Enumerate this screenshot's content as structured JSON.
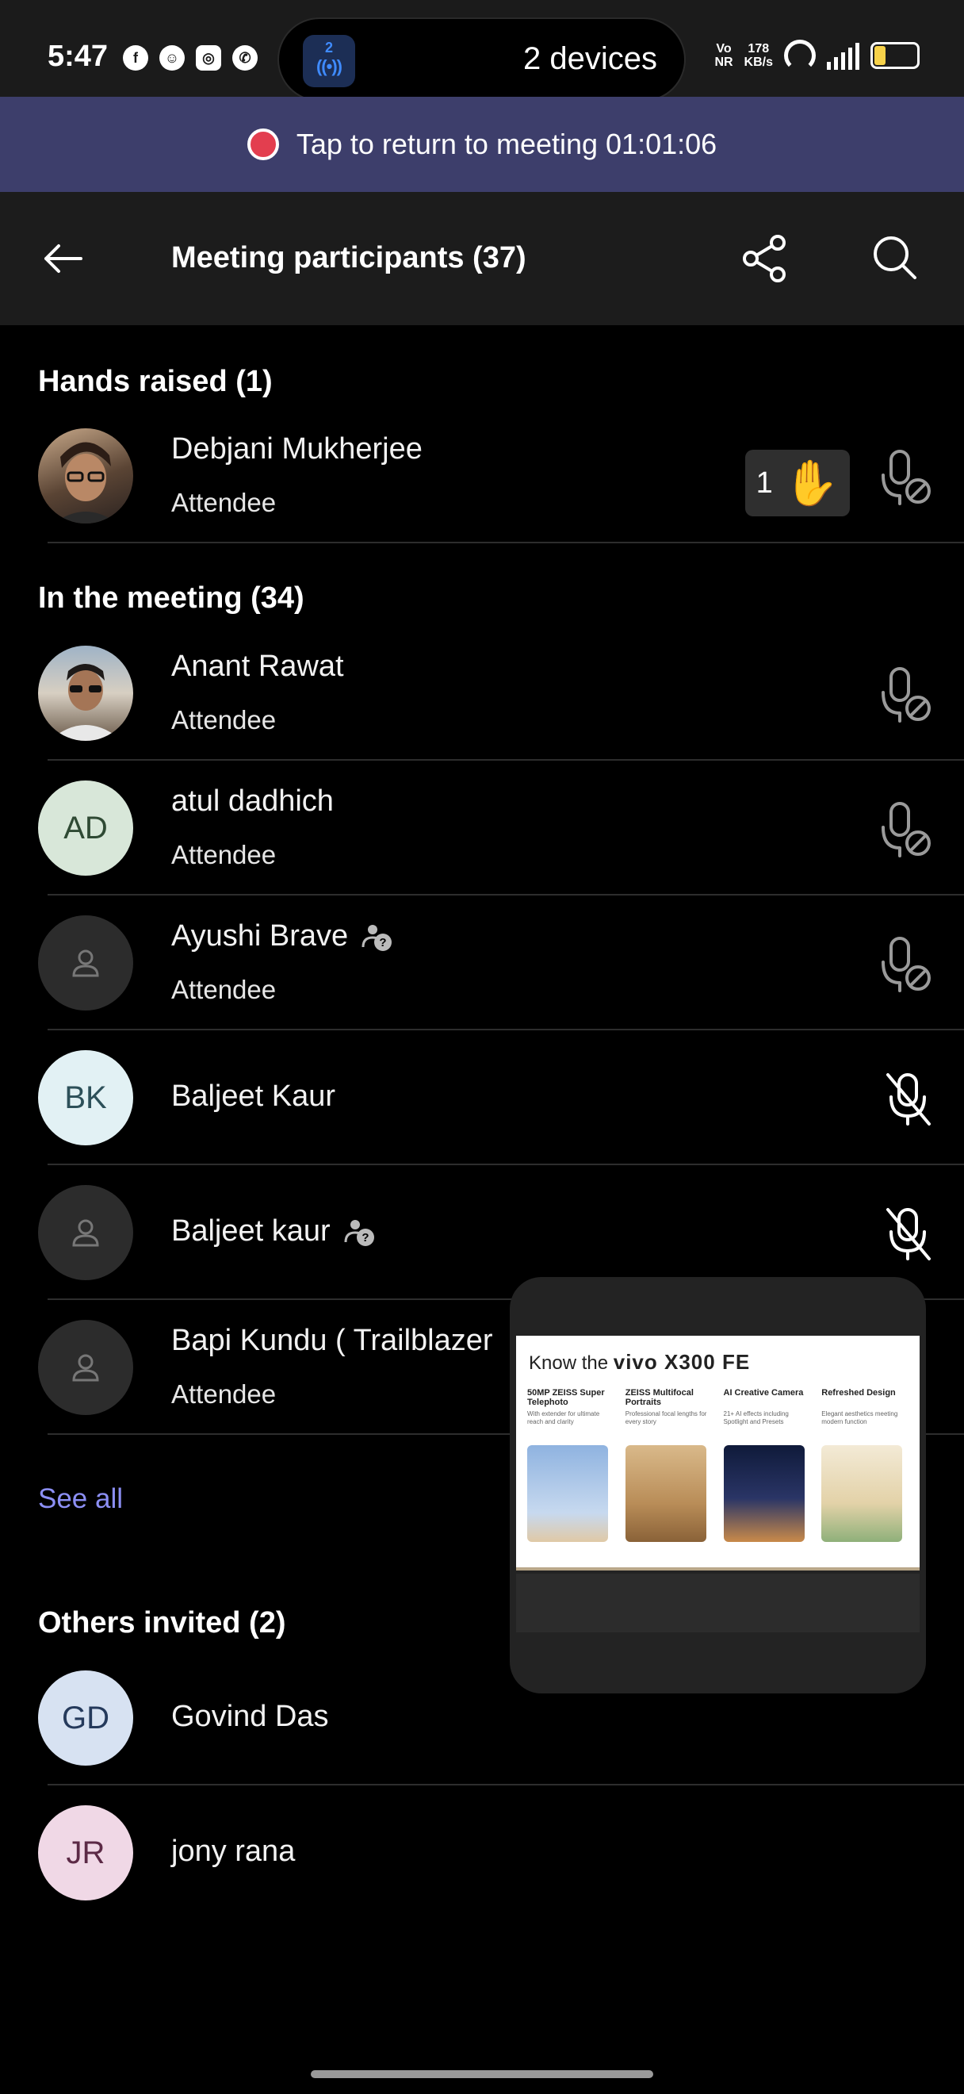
{
  "status_bar": {
    "time": "5:47",
    "apps": [
      "facebook-icon",
      "snapchat-icon",
      "instagram-icon",
      "whatsapp-icon"
    ],
    "island_badge": "2",
    "island_text": "2 devices",
    "volte": "Vo\nNR",
    "speed": "178\nKB/s",
    "network": "5G"
  },
  "banner": {
    "text": "Tap to return to meeting 01:01:06"
  },
  "header": {
    "title": "Meeting participants (37)"
  },
  "sections": {
    "hands_raised": "Hands raised (1)",
    "in_meeting": "In the meeting (34)",
    "others_invited": "Others invited (2)"
  },
  "hands_raised": [
    {
      "name": "Debjani Mukherjee",
      "role": "Attendee",
      "hand_count": "1"
    }
  ],
  "in_meeting": [
    {
      "name": "Anant Rawat",
      "role": "Attendee"
    },
    {
      "name": "atul dadhich",
      "role": "Attendee",
      "initials": "AD"
    },
    {
      "name": "Ayushi Brave",
      "role": "Attendee"
    },
    {
      "name": "Baljeet Kaur",
      "initials": "BK"
    },
    {
      "name": "Baljeet kaur"
    },
    {
      "name": "Bapi Kundu ( Trailblazer",
      "role": "Attendee"
    }
  ],
  "see_all": "See all",
  "others_invited": [
    {
      "name": "Govind Das",
      "initials": "GD"
    },
    {
      "name": "jony rana",
      "initials": "JR"
    }
  ],
  "ad": {
    "title_prefix": "Know the",
    "title_brand": "vivo X300 FE",
    "features": [
      {
        "title": "50MP ZEISS Super Telephoto",
        "desc": "With extender for ultimate reach and clarity"
      },
      {
        "title": "ZEISS Multifocal Portraits",
        "desc": "Professional focal lengths for every story"
      },
      {
        "title": "AI Creative Camera",
        "desc": "21+ AI effects including Spotlight and Presets"
      },
      {
        "title": "Refreshed Design",
        "desc": "Elegant aesthetics meeting modern function"
      }
    ]
  },
  "colors": {
    "banner_bg": "#3d3e6b",
    "link": "#8c8ff5",
    "rec_dot": "#e33e4f"
  }
}
